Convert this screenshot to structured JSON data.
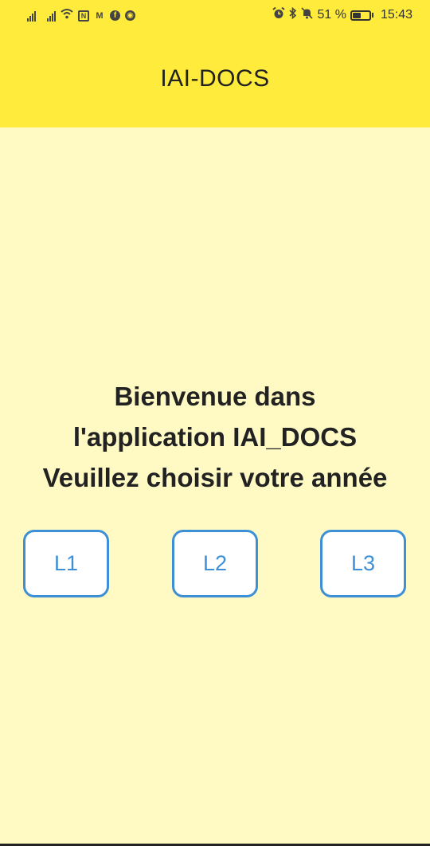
{
  "status_bar": {
    "battery_percent": "51 %",
    "battery_level": 0.51,
    "time": "15:43",
    "left_icons": [
      "signal-icon",
      "signal-icon",
      "wifi-icon",
      "nfc-icon",
      "gmail-icon",
      "facebook-icon",
      "chrome-icon"
    ],
    "right_icons": [
      "alarm-icon",
      "bluetooth-icon",
      "mute-icon",
      "battery-icon"
    ]
  },
  "header": {
    "title": "IAI-DOCS",
    "background_color": "#ffeb3b"
  },
  "main": {
    "background_color": "#fff9c4",
    "welcome_lines": [
      "Bienvenue dans",
      "l'application IAI_DOCS",
      "Veuillez choisir votre année"
    ],
    "year_buttons": [
      {
        "label": "L1"
      },
      {
        "label": "L2"
      },
      {
        "label": "L3"
      }
    ],
    "button_accent_color": "#3d8fd6"
  }
}
